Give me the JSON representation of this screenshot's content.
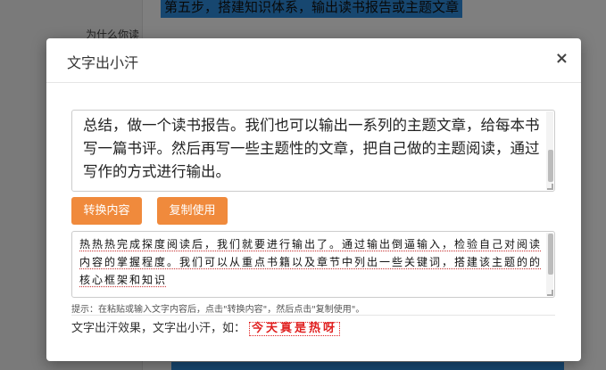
{
  "background": {
    "heading": "第五步，搭建知识体系，输出读书报告或主题文章",
    "question": "为什么你读"
  },
  "modal": {
    "title": "文字出小汗",
    "close_label": "×"
  },
  "input": {
    "text": "总结，做一个读书报告。我们也可以输出一系列的主题文章，给每本书写一篇书评。然后再写一些主题性的文章，把自己做的主题阅读，通过写作的方式进行输出。"
  },
  "buttons": {
    "convert_label": "转换内容",
    "copy_label": "复制使用"
  },
  "output": {
    "text": "热热热完成探度阅读后，我们就要进行输出了。通过输出倒逼输入，检验自己对阅读内容的掌握程度。我们可以从重点书籍以及章节中列出一些关键词，搭建该主题的的核心框架和知识"
  },
  "hint": "提示：在粘贴或输入文字内容后，点击\"转换内容\"，然后点击\"复制使用\"。",
  "effect": {
    "label": "文字出汗效果，文字出小汗，如：",
    "sample": "今天真是热呀"
  },
  "colors": {
    "button_bg": "#f08a3c",
    "accent_blue": "#2f8fe0",
    "sample_red": "#e02020"
  }
}
